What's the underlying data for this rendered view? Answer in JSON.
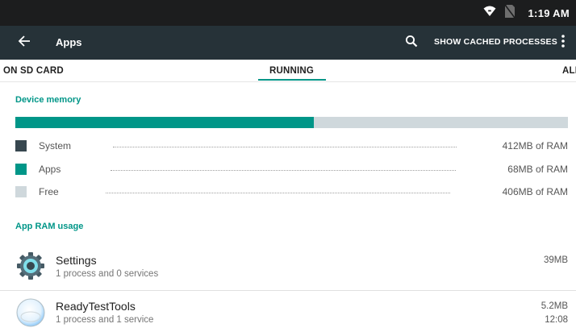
{
  "status_bar": {
    "time": "1:19 AM",
    "icons": [
      "wifi-icon",
      "no-sim-icon"
    ]
  },
  "toolbar": {
    "title": "Apps",
    "show_cached_label": "SHOW CACHED PROCESSES",
    "icons": [
      "back-arrow-icon",
      "search-icon",
      "overflow-menu-icon"
    ]
  },
  "tabs": [
    {
      "label": "ON SD CARD",
      "selected": false
    },
    {
      "label": "RUNNING",
      "selected": true
    },
    {
      "label": "ALL",
      "selected": false
    }
  ],
  "device_memory": {
    "heading": "Device memory",
    "used_fraction": 0.54,
    "legend": [
      {
        "label": "System",
        "value": "412MB of RAM",
        "color": "#37474f"
      },
      {
        "label": "Apps",
        "value": "68MB of RAM",
        "color": "#009688"
      },
      {
        "label": "Free",
        "value": "406MB of RAM",
        "color": "#cfd8dc"
      }
    ]
  },
  "app_ram": {
    "heading": "App RAM usage",
    "apps": [
      {
        "name": "Settings",
        "detail": "1 process and 0 services",
        "size": "39MB",
        "time": "",
        "icon": "settings-gear-icon"
      },
      {
        "name": "ReadyTestTools",
        "detail": "1 process and 1 service",
        "size": "5.2MB",
        "time": "12:08",
        "icon": "ready-test-tools-icon"
      }
    ]
  },
  "colors": {
    "accent": "#009688",
    "toolbar": "#263238",
    "status_bar": "#1c1d1e",
    "bar_track": "#cfd8dc"
  }
}
